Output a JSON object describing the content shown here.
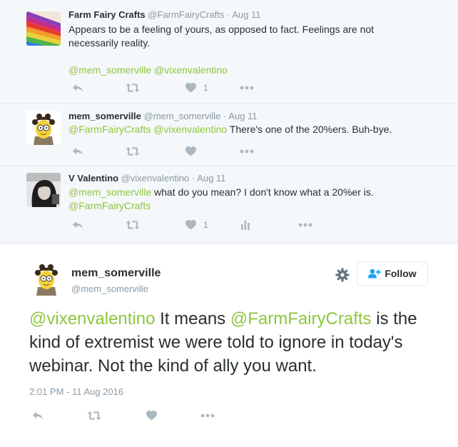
{
  "thread": [
    {
      "name": "Farm Fairy Crafts",
      "handle": "@FarmFairyCrafts",
      "date": "Aug 11",
      "text": "Appears to be a feeling of yours, as opposed to fact. Feelings are not necessarily reality.",
      "mentions": "@mem_somerville @vixenvalentino",
      "like_count": "1"
    },
    {
      "name": "mem_somerville",
      "handle": "@mem_somerville",
      "date": "Aug 11",
      "mentions": "@FarmFairyCrafts @vixenvalentino",
      "text": "There's one of the 20%ers. Buh-bye."
    },
    {
      "name": "V Valentino",
      "handle": "@vixenvalentino",
      "date": "Aug 11",
      "mention1": "@mem_somerville",
      "text": "what do you mean? I don't know what a 20%er is.",
      "mention2": "@FarmFairyCrafts",
      "like_count": "1"
    }
  ],
  "main": {
    "name": "mem_somerville",
    "handle": "@mem_somerville",
    "follow_label": "Follow",
    "mention1": "@vixenvalentino",
    "text1": "It means",
    "mention2": "@FarmFairyCrafts",
    "text2": "is the kind of extremist we were told to ignore in today's webinar. Not the kind of ally you want.",
    "timestamp": "2:01 PM - 11 Aug 2016"
  },
  "colors": {
    "mention": "#8ec63f",
    "icon": "#aab8c2",
    "meta": "#8899a6",
    "follow_icon": "#1da1f2"
  }
}
